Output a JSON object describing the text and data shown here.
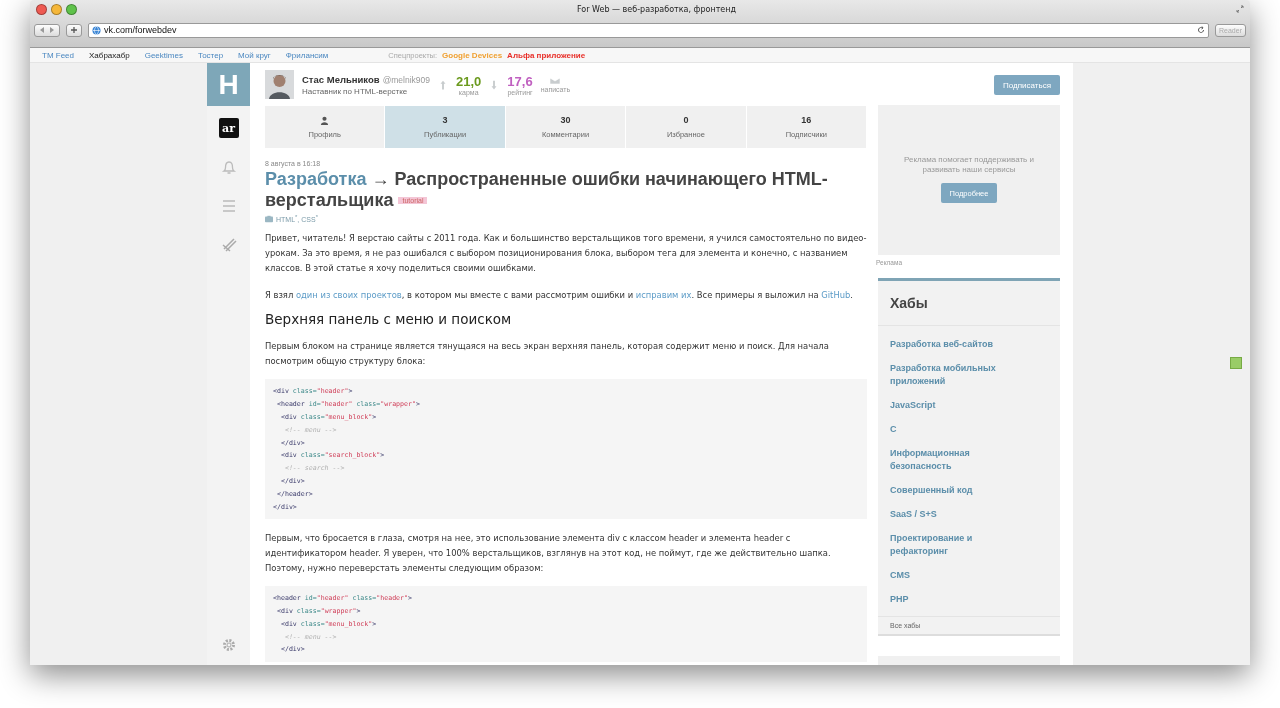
{
  "browser": {
    "title": "For Web — веб-разработка, фронтенд",
    "url": "vk.com/forwebdev",
    "reader": "Reader"
  },
  "topnav": [
    {
      "label": "TM Feed",
      "selected": false
    },
    {
      "label": "Хабрахабр",
      "selected": true
    },
    {
      "label": "Geektimes",
      "selected": false
    },
    {
      "label": "Тостер",
      "selected": false
    },
    {
      "label": "Мой круг",
      "selected": false
    },
    {
      "label": "Фрилансим",
      "selected": false
    }
  ],
  "special": {
    "label": "Спецпроекты:",
    "items": [
      {
        "label": "Google Devices",
        "color": "#f0a030"
      },
      {
        "label": "Альфа приложение",
        "color": "#e8302a"
      }
    ]
  },
  "sidebar": {
    "logo": "H",
    "badge": "ar"
  },
  "profile": {
    "name": "Стас Мельников",
    "handle": "@melnik909",
    "subtitle": "Наставник по HTML-верстке",
    "karma": "21,0",
    "karma_label": "карма",
    "rating": "17,6",
    "rating_label": "рейтинг",
    "write_label": "написать",
    "subscribe": "Подписаться"
  },
  "tabs": [
    {
      "kind": "icon",
      "label": "Профиль",
      "selected": false
    },
    {
      "kind": "count",
      "count": "3",
      "label": "Публикации",
      "selected": true
    },
    {
      "kind": "count",
      "count": "30",
      "label": "Комментарии",
      "selected": false
    },
    {
      "kind": "count",
      "count": "0",
      "label": "Избранное",
      "selected": false
    },
    {
      "kind": "count",
      "count": "16",
      "label": "Подписчики",
      "selected": false
    }
  ],
  "article": {
    "date": "8 августа в 16:18",
    "hub": "Разработка",
    "arrow": "→",
    "title": "Распространенные ошибки начинающего HTML-верстальщика",
    "tag": "tutorial",
    "hubs": "HTML$^{*}$, CSS$^{*}$",
    "blocks": [
      {
        "kind": "paragraph",
        "parts": [
          {
            "text": "Привет, читатель! Я верстаю сайты с 2011 года. Как и большинство верстальщиков того времени, я учился самостоятельно по видео-урокам. За это время, я не раз ошибался с выбором позиционирования блока, выбором тега для элемента и конечно, с названием классов. В этой статье я хочу поделиться своими ошибками."
          }
        ]
      },
      {
        "kind": "paragraph",
        "parts": [
          {
            "text": "Я взял "
          },
          {
            "text": "один из своих проектов",
            "link": true
          },
          {
            "text": ", в котором мы вместе с вами рассмотрим ошибки и "
          },
          {
            "text": "исправим их",
            "link": true
          },
          {
            "text": ". Все примеры я выложил на "
          },
          {
            "text": "GitHub",
            "link": true
          },
          {
            "text": "."
          }
        ]
      },
      {
        "kind": "heading",
        "text": "Верхняя панель с меню и поиском"
      },
      {
        "kind": "paragraph",
        "parts": [
          {
            "text": "Первым блоком на странице является тянущаяся на весь экран верхняя панель, которая содержит меню и поиск. Для начала посмотрим общую структуру блока:"
          }
        ]
      },
      {
        "kind": "code",
        "lines": [
          [
            {
              "kind": "tag",
              "text": "<div "
            },
            {
              "kind": "attr",
              "text": "class="
            },
            {
              "kind": "string",
              "text": "\"header\""
            },
            {
              "kind": "tag",
              "text": ">"
            }
          ],
          [
            {
              "kind": "tag",
              "text": " <header "
            },
            {
              "kind": "attr",
              "text": "id="
            },
            {
              "kind": "string",
              "text": "\"header\" "
            },
            {
              "kind": "attr",
              "text": "class="
            },
            {
              "kind": "string",
              "text": "\"wrapper\""
            },
            {
              "kind": "tag",
              "text": ">"
            }
          ],
          [
            {
              "kind": "tag",
              "text": "  <div "
            },
            {
              "kind": "attr",
              "text": "class="
            },
            {
              "kind": "string",
              "text": "\"menu_block\""
            },
            {
              "kind": "tag",
              "text": ">"
            }
          ],
          [
            {
              "kind": "comment",
              "text": "   <!-- menu -->"
            }
          ],
          [
            {
              "kind": "tag",
              "text": "  </div>"
            }
          ],
          [
            {
              "kind": "tag",
              "text": "  <div "
            },
            {
              "kind": "attr",
              "text": "class="
            },
            {
              "kind": "string",
              "text": "\"search_block\""
            },
            {
              "kind": "tag",
              "text": ">"
            }
          ],
          [
            {
              "kind": "comment",
              "text": "   <!-- search -->"
            }
          ],
          [
            {
              "kind": "tag",
              "text": "  </div>"
            }
          ],
          [
            {
              "kind": "tag",
              "text": " </header>"
            }
          ],
          [
            {
              "kind": "tag",
              "text": "</div>"
            }
          ]
        ]
      },
      {
        "kind": "paragraph",
        "parts": [
          {
            "text": "Первым, что бросается в глаза, смотря на нее, это использование элемента div с классом header и элемента header с идентификатором header. Я уверен, что 100% верстальщиков, взглянув на этот код, не поймут, где же действительно шапка. Поэтому, нужно переверстать элементы следующим образом:"
          }
        ]
      },
      {
        "kind": "code",
        "lines": [
          [
            {
              "kind": "tag",
              "text": "<header "
            },
            {
              "kind": "attr",
              "text": "id="
            },
            {
              "kind": "string",
              "text": "\"header\" "
            },
            {
              "kind": "attr",
              "text": "class="
            },
            {
              "kind": "string",
              "text": "\"header\""
            },
            {
              "kind": "tag",
              "text": ">"
            }
          ],
          [
            {
              "kind": "tag",
              "text": " <div "
            },
            {
              "kind": "attr",
              "text": "class="
            },
            {
              "kind": "string",
              "text": "\"wrapper\""
            },
            {
              "kind": "tag",
              "text": ">"
            }
          ],
          [
            {
              "kind": "tag",
              "text": "  <div "
            },
            {
              "kind": "attr",
              "text": "class="
            },
            {
              "kind": "string",
              "text": "\"menu_block\""
            },
            {
              "kind": "tag",
              "text": ">"
            }
          ],
          [
            {
              "kind": "comment",
              "text": "   <!-- menu -->"
            }
          ],
          [
            {
              "kind": "tag",
              "text": "  </div>"
            }
          ]
        ]
      }
    ]
  },
  "ad": {
    "text": "Реклама помогает поддерживать и развивать наши сервисы",
    "button": "Подробнее",
    "label": "Реклама"
  },
  "hubs_panel": {
    "title": "Хабы",
    "items": [
      "Разработка веб-сайтов",
      "Разработка мобильных приложений",
      "JavaScript",
      "C",
      "Информационная безопасность",
      "Совершенный код",
      "SaaS / S+S",
      "Проектирование и рефакторинг",
      "CMS",
      "PHP"
    ],
    "all": "Все хабы"
  }
}
